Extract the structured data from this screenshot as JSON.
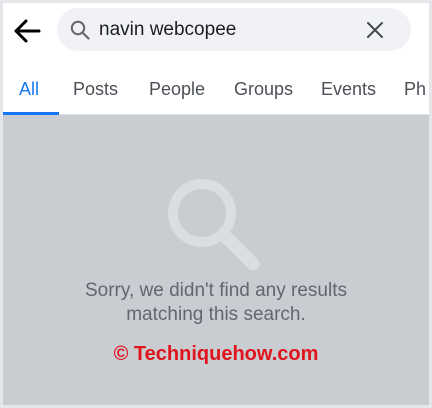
{
  "search": {
    "query": "navin webcopee"
  },
  "tabs": [
    {
      "label": "All",
      "active": true
    },
    {
      "label": "Posts",
      "active": false
    },
    {
      "label": "People",
      "active": false
    },
    {
      "label": "Groups",
      "active": false
    },
    {
      "label": "Events",
      "active": false
    },
    {
      "label": "Ph",
      "active": false
    }
  ],
  "empty_state": {
    "line1": "Sorry, we didn't find any results",
    "line2": "matching this search."
  },
  "watermark": "© Techniquehow.com",
  "colors": {
    "accent": "#1877f2",
    "content_bg": "#c9ccd1",
    "watermark": "#e0141c"
  },
  "icons": {
    "back": "arrow-left-icon",
    "search": "search-icon",
    "clear": "close-icon",
    "empty": "magnifier-icon"
  }
}
